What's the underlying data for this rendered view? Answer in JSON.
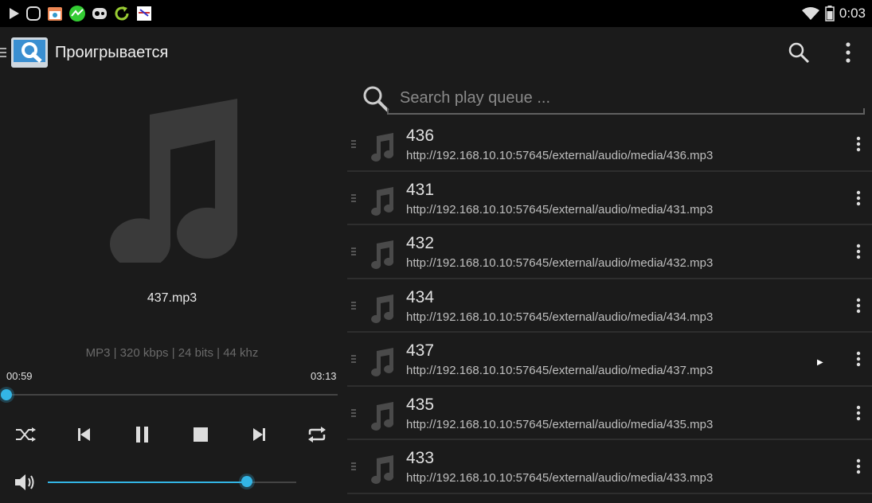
{
  "status_bar": {
    "time": "0:03",
    "notification_icons": [
      "play-icon",
      "browser-icon",
      "calendar-icon",
      "stocks-icon",
      "gamepad-icon",
      "refresh-icon",
      "usb-icon"
    ]
  },
  "action_bar": {
    "title": "Проигрывается",
    "actions": [
      "search-icon",
      "overflow-menu-icon"
    ]
  },
  "now_playing": {
    "track_name": "437.mp3",
    "meta": "MP3 | 320 kbps | 24 bits | 44  khz",
    "current_time": "00:59",
    "total_time": "03:13",
    "progress_fraction": 0.0,
    "volume_fraction": 0.8
  },
  "controls": [
    "shuffle-icon",
    "previous-icon",
    "pause-icon",
    "stop-icon",
    "next-icon",
    "repeat-icon"
  ],
  "search": {
    "placeholder": "Search play queue ..."
  },
  "queue": [
    {
      "title": "436",
      "url": "http://192.168.10.10:57645/external/audio/media/436.mp3",
      "playing": false
    },
    {
      "title": "431",
      "url": "http://192.168.10.10:57645/external/audio/media/431.mp3",
      "playing": false
    },
    {
      "title": "432",
      "url": "http://192.168.10.10:57645/external/audio/media/432.mp3",
      "playing": false
    },
    {
      "title": "434",
      "url": "http://192.168.10.10:57645/external/audio/media/434.mp3",
      "playing": false
    },
    {
      "title": "437",
      "url": "http://192.168.10.10:57645/external/audio/media/437.mp3",
      "playing": true
    },
    {
      "title": "435",
      "url": "http://192.168.10.10:57645/external/audio/media/435.mp3",
      "playing": false
    },
    {
      "title": "433",
      "url": "http://192.168.10.10:57645/external/audio/media/433.mp3",
      "playing": false
    }
  ],
  "colors": {
    "accent": "#33b5e5",
    "background": "#1b1b1b",
    "status_bar": "#000000"
  }
}
